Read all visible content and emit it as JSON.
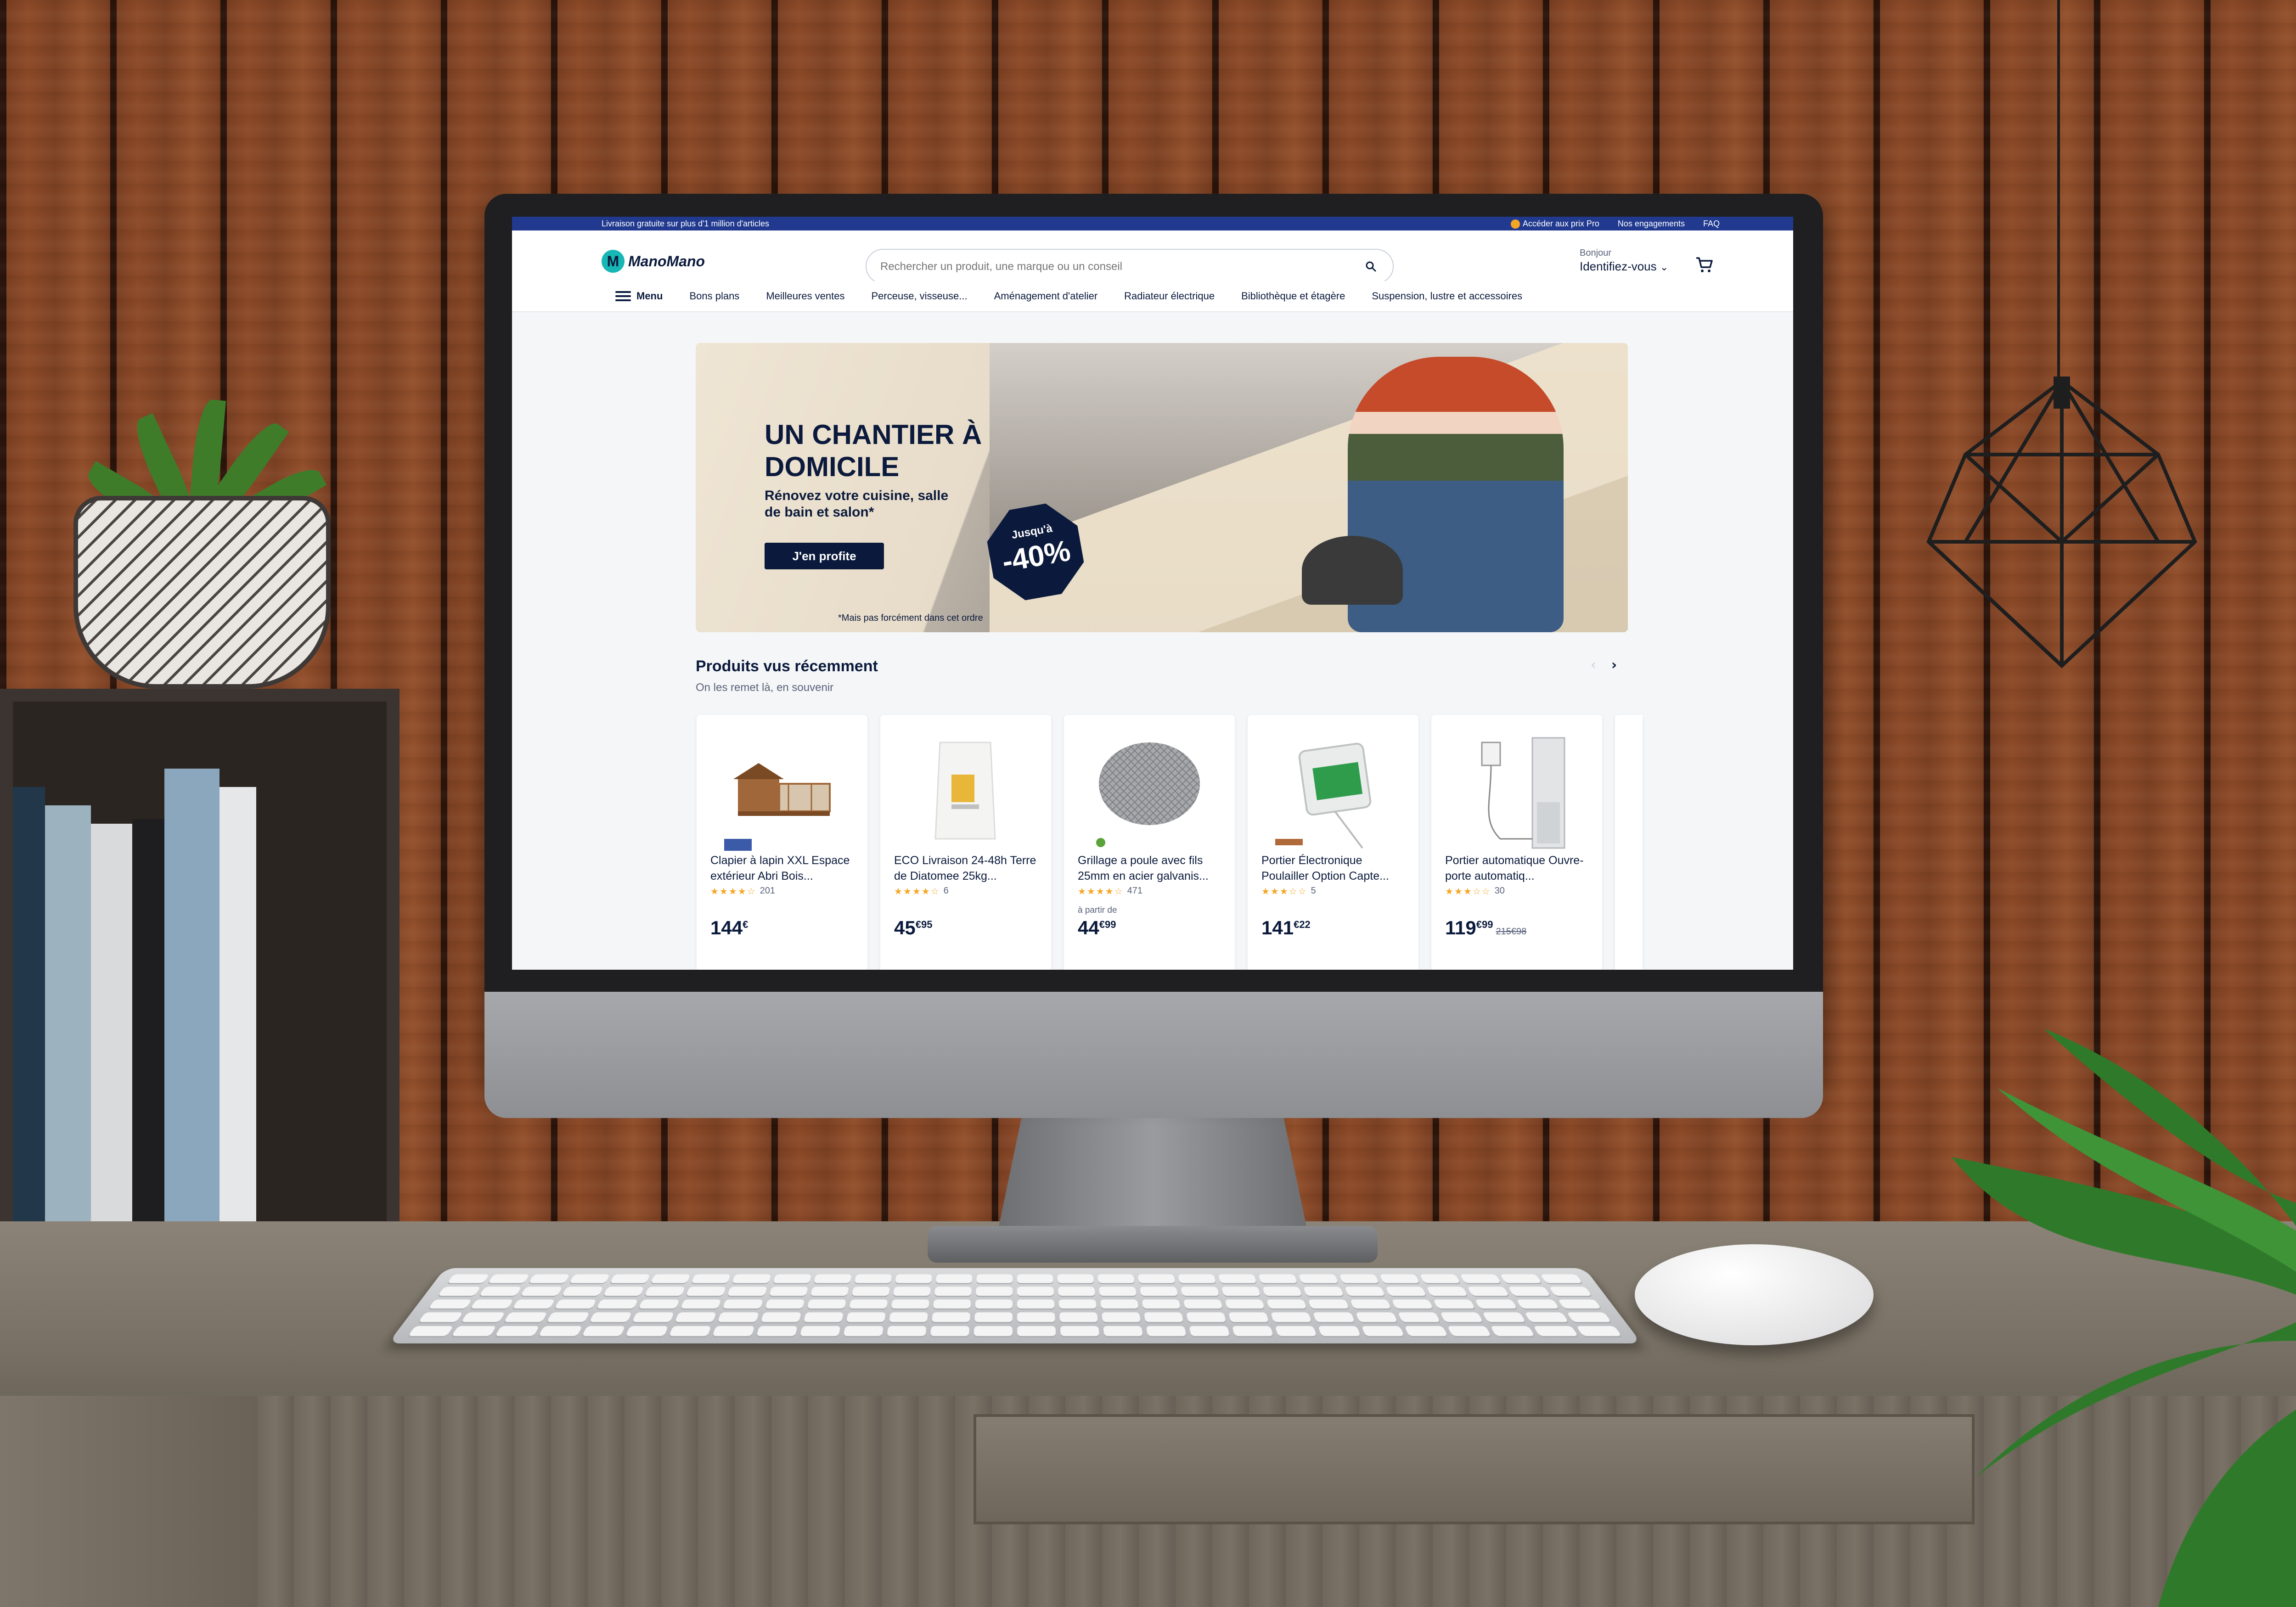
{
  "topbar": {
    "promo": "Livraison gratuite sur plus d'1 million d'articles",
    "pro_link": "Accéder aux prix Pro",
    "engagements": "Nos engagements",
    "faq": "FAQ"
  },
  "header": {
    "logo_text": "ManoMano",
    "logo_letter": "M",
    "search_placeholder": "Rechercher un produit, une marque ou un conseil",
    "greeting": "Bonjour",
    "account_label": "Identifiez-vous",
    "account_chevron": "⌄"
  },
  "nav": {
    "menu_label": "Menu",
    "items": [
      "Bons plans",
      "Meilleures ventes",
      "Perceuse, visseuse...",
      "Aménagement d'atelier",
      "Radiateur électrique",
      "Bibliothèque et étagère",
      "Suspension, lustre et accessoires"
    ]
  },
  "hero": {
    "title": "UN CHANTIER À DOMICILE",
    "subtitle": "Rénovez votre cuisine, salle de bain et salon*",
    "cta": "J'en profite",
    "badge_upto": "Jusqu'à",
    "badge_pct": "-40%",
    "note": "*Mais pas forcément dans cet ordre"
  },
  "recent": {
    "title": "Produits vus récemment",
    "subtitle": "On les remet là, en souvenir",
    "prev_arrow": "‹",
    "next_arrow": "›",
    "products": [
      {
        "name": "Clapier à lapin XXL Espace extérieur Abri Bois...",
        "stars": "★★★★☆",
        "rating_value": 3.5,
        "reviews": "201",
        "from": "",
        "price_main": "144",
        "price_cents": "€",
        "old_price": ""
      },
      {
        "name": "ECO Livraison 24-48h Terre de Diatomee 25kg...",
        "stars": "★★★★☆",
        "rating_value": 4,
        "reviews": "6",
        "from": "",
        "price_main": "45",
        "price_cents": "€95",
        "old_price": ""
      },
      {
        "name": "Grillage a poule avec fils 25mm en acier galvanis...",
        "stars": "★★★★☆",
        "rating_value": 4,
        "reviews": "471",
        "from": "à partir de",
        "price_main": "44",
        "price_cents": "€99",
        "old_price": ""
      },
      {
        "name": "Portier Électronique Poulailler Option Capte...",
        "stars": "★★★☆☆",
        "rating_value": 3,
        "reviews": "5",
        "from": "",
        "price_main": "141",
        "price_cents": "€22",
        "old_price": ""
      },
      {
        "name": "Portier automatique Ouvre-porte automatiq...",
        "stars": "★★★☆☆",
        "rating_value": 3,
        "reviews": "30",
        "from": "",
        "price_main": "119",
        "price_cents": "€99",
        "old_price": "215€98"
      }
    ]
  },
  "colors": {
    "brand_navy": "#0b1a3c",
    "topbar_blue": "#213a8f",
    "logo_teal": "#16b7b4",
    "star": "#f5a623"
  }
}
